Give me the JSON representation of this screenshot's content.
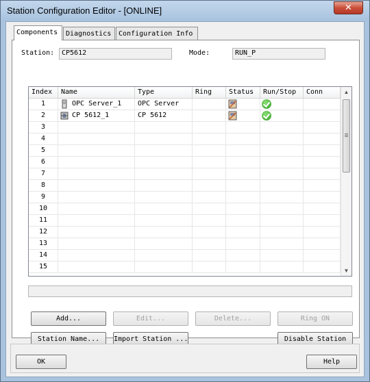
{
  "window": {
    "title": "Station Configuration Editor - [ONLINE]",
    "close_glyph": "✕"
  },
  "tabs": [
    {
      "label": "Components",
      "active": true
    },
    {
      "label": "Diagnostics",
      "active": false
    },
    {
      "label": "Configuration Info",
      "active": false
    }
  ],
  "station": {
    "label": "Station:",
    "value": "CP5612"
  },
  "mode": {
    "label": "Mode:",
    "value": "RUN_P"
  },
  "table": {
    "columns": [
      "Index",
      "Name",
      "Type",
      "Ring",
      "Status",
      "Run/Stop",
      "Conn"
    ],
    "rows": [
      {
        "index": "1",
        "name": "OPC Server_1",
        "type": "OPC Server",
        "icon": "opc-server-icon",
        "has_status": true,
        "running": true
      },
      {
        "index": "2",
        "name": "CP 5612_1",
        "type": "CP 5612",
        "icon": "cp-card-icon",
        "has_status": true,
        "running": true
      },
      {
        "index": "3"
      },
      {
        "index": "4"
      },
      {
        "index": "5"
      },
      {
        "index": "6"
      },
      {
        "index": "7"
      },
      {
        "index": "8"
      },
      {
        "index": "9"
      },
      {
        "index": "10"
      },
      {
        "index": "11"
      },
      {
        "index": "12"
      },
      {
        "index": "13"
      },
      {
        "index": "14"
      },
      {
        "index": "15"
      }
    ]
  },
  "buttons": {
    "add": "Add...",
    "edit": "Edit...",
    "delete": "Delete...",
    "ring_on": "Ring ON",
    "station_name": "Station Name...",
    "import_station": "Import Station ...",
    "disable_station": "Disable Station",
    "ok": "OK",
    "help": "Help"
  },
  "colors": {
    "titlebar": "#a9c3de",
    "close": "#c94f3a",
    "ok_green": "#2f9a22"
  }
}
